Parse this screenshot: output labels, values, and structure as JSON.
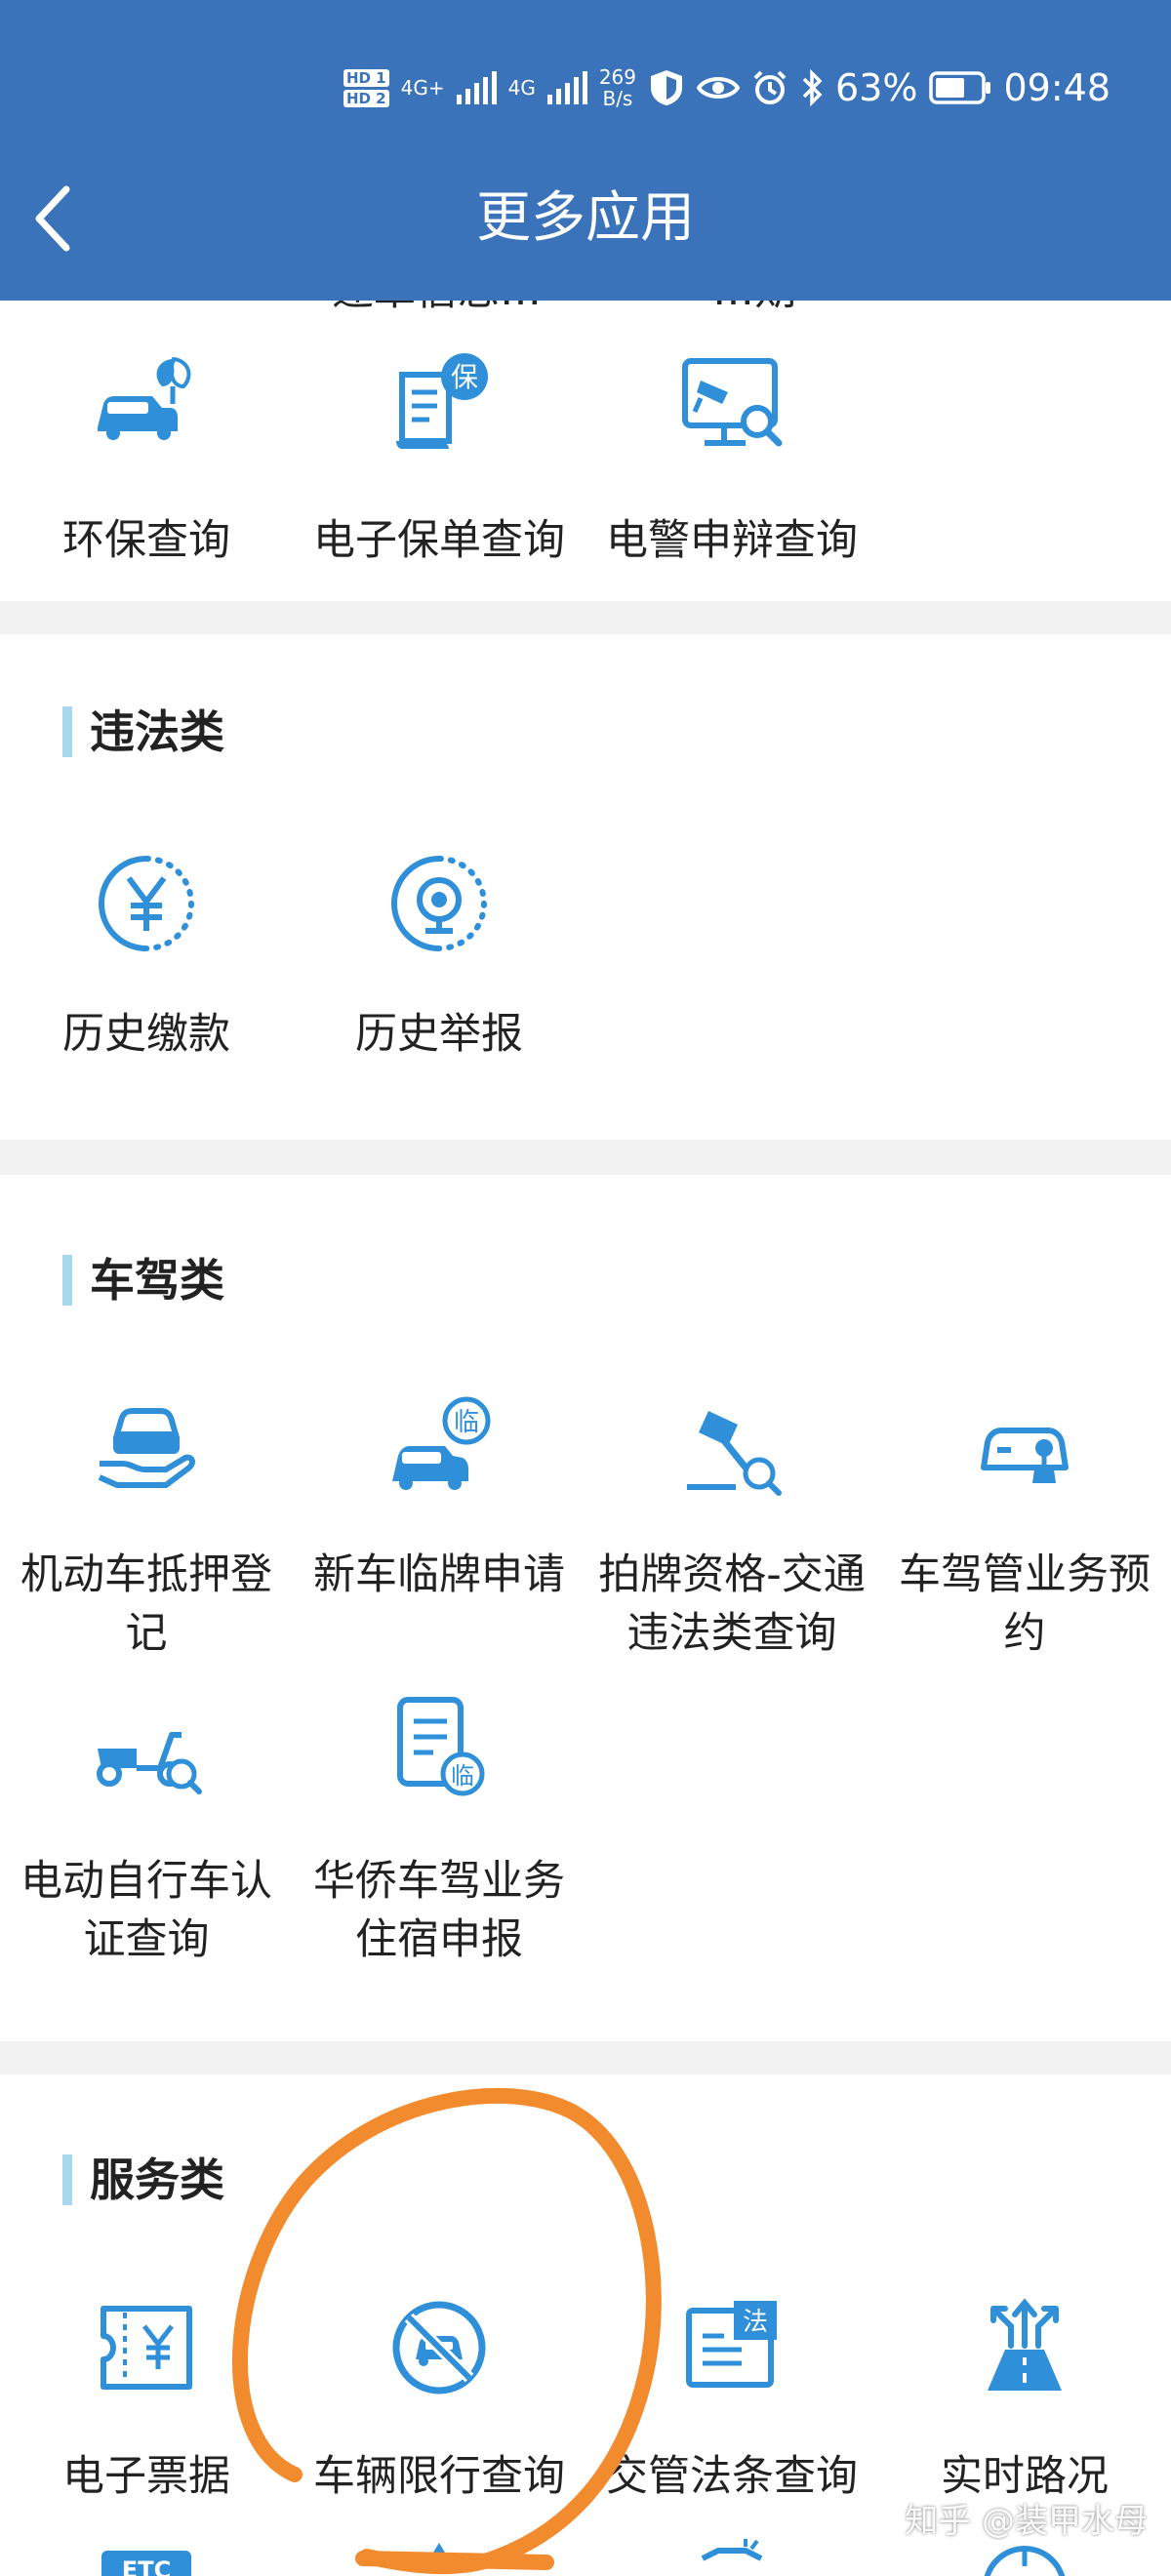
{
  "status_bar": {
    "hd1": "HD 1",
    "hd2": "HD 2",
    "net1": "4G+",
    "net2": "4G",
    "speed_value": "269",
    "speed_unit": "B/s",
    "battery": "63%",
    "time": "09:48"
  },
  "header": {
    "title": "更多应用"
  },
  "top_section": {
    "partial_labels": [
      "违章信息…",
      "…期"
    ],
    "items": [
      {
        "label": "环保查询",
        "icon": "car-leaf-icon"
      },
      {
        "label": "电子保单查询",
        "icon": "insurance-document-icon"
      },
      {
        "label": "电警申辩查询",
        "icon": "monitor-camera-search-icon"
      }
    ]
  },
  "violation_section": {
    "title": "违法类",
    "items": [
      {
        "label": "历史缴款",
        "icon": "yen-circle-icon"
      },
      {
        "label": "历史举报",
        "icon": "camera-circle-icon"
      }
    ]
  },
  "vehicle_section": {
    "title": "车驾类",
    "items": [
      {
        "label": "机动车抵押登记",
        "icon": "car-hand-icon"
      },
      {
        "label": "新车临牌申请",
        "icon": "car-temp-plate-icon"
      },
      {
        "label": "拍牌资格-交通违法类查询",
        "icon": "gavel-search-icon"
      },
      {
        "label": "车驾管业务预约",
        "icon": "car-stamp-icon"
      },
      {
        "label": "电动自行车认证查询",
        "icon": "scooter-search-icon"
      },
      {
        "label": "华侨车驾业务住宿申报",
        "icon": "document-temp-icon"
      }
    ]
  },
  "service_section": {
    "title": "服务类",
    "items": [
      {
        "label": "电子票据",
        "icon": "yen-ticket-icon"
      },
      {
        "label": "车辆限行查询",
        "icon": "no-car-icon"
      },
      {
        "label": "交管法条查询",
        "icon": "law-book-icon"
      },
      {
        "label": "实时路况",
        "icon": "road-arrows-icon"
      }
    ],
    "partial_row": [
      {
        "label": "ETC",
        "icon": "etc-card-icon"
      }
    ]
  },
  "watermark": "知乎 @装甲水母",
  "colors": {
    "header_bg": "#3b73bb",
    "icon_blue": "#2f8fd8",
    "section_bar": "#a9d8ec",
    "annotation_orange": "#f28a2e"
  }
}
